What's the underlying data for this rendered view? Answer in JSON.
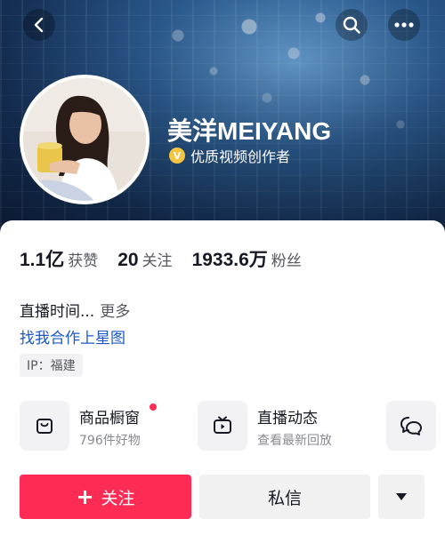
{
  "header": {
    "username": "美洋MEIYANG",
    "verify_badge": "V",
    "verify_text": "优质视频创作者"
  },
  "stats": [
    {
      "value": "1.1亿",
      "label": "获赞"
    },
    {
      "value": "20",
      "label": "关注"
    },
    {
      "value": "1933.6万",
      "label": "粉丝"
    }
  ],
  "bio": {
    "text": "直播时间...",
    "more": "更多",
    "link": "找我合作上星图",
    "ip": "IP：福建"
  },
  "services": [
    {
      "title": "商品橱窗",
      "subtitle": "796件好物",
      "icon": "bag-icon",
      "has_dot": true
    },
    {
      "title": "直播动态",
      "subtitle": "查看最新回放",
      "icon": "tv-icon"
    },
    {
      "icon": "chat-bubbles-icon"
    }
  ],
  "actions": {
    "follow_icon": "+",
    "follow": "关注",
    "message": "私信"
  },
  "colors": {
    "accent": "#fe2c55",
    "link": "#1b57c9",
    "badge": "#f5c542"
  }
}
